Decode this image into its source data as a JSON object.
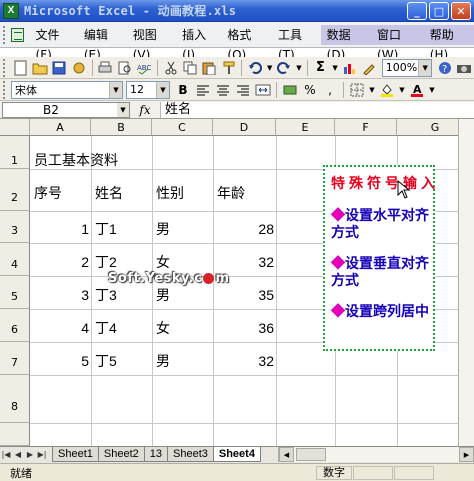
{
  "window": {
    "title": "Microsoft Excel - 动画教程.xls",
    "app_icon_letter": "X"
  },
  "menu": {
    "items": [
      "文件(F)",
      "编辑(E)",
      "视图(V)",
      "插入(I)",
      "格式(O)",
      "工具(T)",
      "数据(D)",
      "窗口(W)",
      "帮助(H)"
    ]
  },
  "toolbar": {
    "zoom": "100%",
    "font_name": "宋体",
    "font_size": "12",
    "bold_label": "B"
  },
  "formula_bar": {
    "name_box": "B2",
    "fx_label": "fx",
    "content": "姓名"
  },
  "grid": {
    "columns": [
      "A",
      "B",
      "C",
      "D",
      "E",
      "F",
      "G"
    ],
    "rows": [
      "1",
      "2",
      "3",
      "4",
      "5",
      "6",
      "7",
      "8"
    ],
    "title_cell": "员工基本资料",
    "headers": [
      "序号",
      "姓名",
      "性别",
      "年龄"
    ],
    "records": [
      {
        "id": "1",
        "name": "丁1",
        "gender": "男",
        "age": "28"
      },
      {
        "id": "2",
        "name": "丁2",
        "gender": "女",
        "age": "32"
      },
      {
        "id": "3",
        "name": "丁3",
        "gender": "男",
        "age": "35"
      },
      {
        "id": "4",
        "name": "丁4",
        "gender": "女",
        "age": "36"
      },
      {
        "id": "5",
        "name": "丁5",
        "gender": "男",
        "age": "32"
      }
    ]
  },
  "textbox": {
    "title": "特殊符号输入",
    "items": [
      "◆设置水平对齐方式",
      "◆设置垂直对齐方式",
      "◆设置跨列居中"
    ]
  },
  "watermark": "Soft.Yesky.c",
  "watermark_tail": "m",
  "sheet_tabs": [
    "Sheet1",
    "Sheet2",
    "13",
    "Sheet3",
    "Sheet4"
  ],
  "active_tab": "Sheet4",
  "status": {
    "left": "就绪",
    "mode": "数字"
  },
  "colors": {
    "title_bar": "#2f62d2",
    "textbox_border": "#22a23a",
    "textbox_title": "#e8001e",
    "textbox_items": "#1400b8",
    "diamond": "#e000b8"
  }
}
